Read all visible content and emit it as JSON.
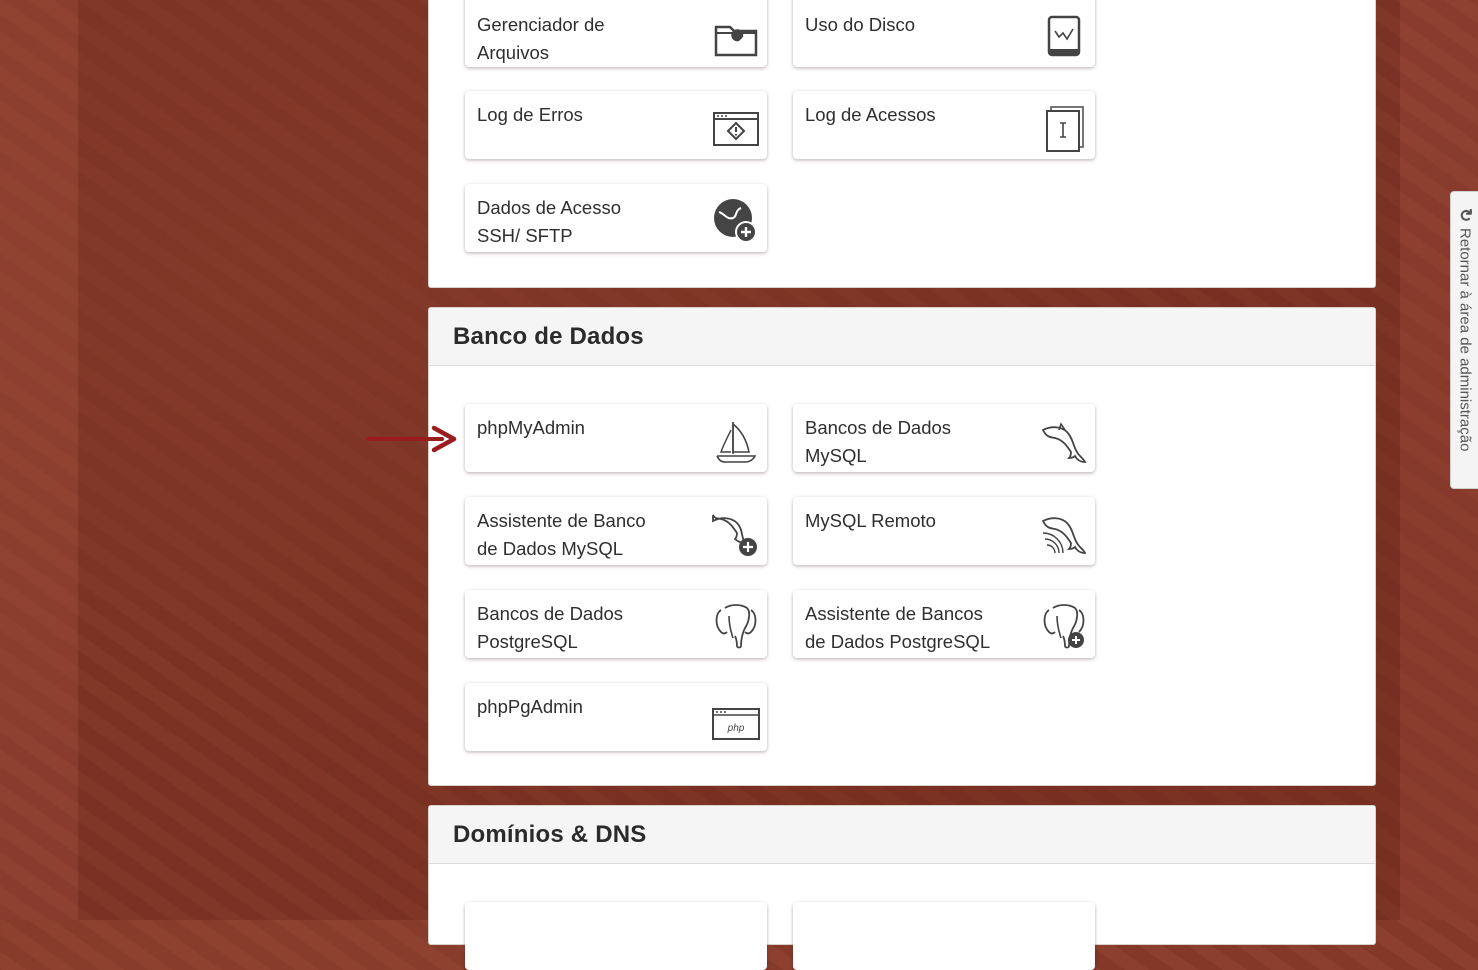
{
  "sections": {
    "files": {
      "items": [
        {
          "label": "Gerenciador de Arquivos",
          "icon": "folder-wrench-icon"
        },
        {
          "label": "Uso do Disco",
          "icon": "disk-usage-icon"
        },
        {
          "label": "Log de Erros",
          "icon": "error-log-icon"
        },
        {
          "label": "Log de Acessos",
          "icon": "access-log-icon"
        },
        {
          "label": "Dados de Acesso SSH/ SFTP",
          "icon": "globe-plus-icon"
        }
      ]
    },
    "databases": {
      "title": "Banco de Dados",
      "items": [
        {
          "label": "phpMyAdmin",
          "icon": "sailboat-icon"
        },
        {
          "label": "Bancos de Dados MySQL",
          "icon": "dolphin-icon"
        },
        {
          "label": "Assistente de Banco de Dados MySQL",
          "icon": "dolphin-plus-icon"
        },
        {
          "label": "MySQL Remoto",
          "icon": "dolphin-wifi-icon"
        },
        {
          "label": "Bancos de Dados PostgreSQL",
          "icon": "elephant-icon"
        },
        {
          "label": "Assistente de Bancos de Dados PostgreSQL",
          "icon": "elephant-plus-icon"
        },
        {
          "label": "phpPgAdmin",
          "icon": "php-window-icon"
        }
      ]
    },
    "domains": {
      "title": "Domínios & DNS"
    }
  },
  "side_tab": {
    "label": "Retornar à área de administração",
    "icon": "refresh-icon"
  },
  "colors": {
    "background": "#8a3b2a",
    "arrow": "#9b1c1c",
    "panel_header": "#f5f5f5"
  }
}
